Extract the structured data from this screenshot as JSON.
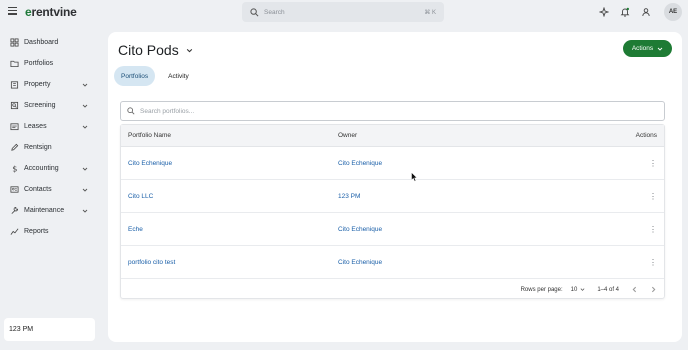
{
  "app": {
    "logo_prefix": "e",
    "logo_rest": "rentvine"
  },
  "topbar": {
    "search_placeholder": "Search",
    "search_shortcut": "⌘ K",
    "icons": [
      "sparkle-icon",
      "bell-icon",
      "user-settings-icon"
    ],
    "avatar_initials": "AE"
  },
  "sidebar": {
    "items": [
      {
        "label": "Dashboard",
        "icon": "dashboard-icon",
        "expandable": false
      },
      {
        "label": "Portfolios",
        "icon": "folder-icon",
        "expandable": false
      },
      {
        "label": "Property",
        "icon": "building-icon",
        "expandable": true
      },
      {
        "label": "Screening",
        "icon": "screening-icon",
        "expandable": true
      },
      {
        "label": "Leases",
        "icon": "lease-icon",
        "expandable": true
      },
      {
        "label": "Rentsign",
        "icon": "pen-icon",
        "expandable": false
      },
      {
        "label": "Accounting",
        "icon": "dollar-icon",
        "expandable": true
      },
      {
        "label": "Contacts",
        "icon": "contacts-icon",
        "expandable": true
      },
      {
        "label": "Maintenance",
        "icon": "wrench-icon",
        "expandable": true
      },
      {
        "label": "Reports",
        "icon": "chart-icon",
        "expandable": false
      }
    ],
    "account_name": "123 PM"
  },
  "main": {
    "title": "Cito Pods",
    "actions_label": "Actions",
    "tabs": [
      {
        "label": "Portfolios",
        "active": true
      },
      {
        "label": "Activity",
        "active": false
      }
    ],
    "search_placeholder": "Search portfolios...",
    "table": {
      "headers": [
        "Portfolio Name",
        "Owner",
        "Actions"
      ],
      "rows": [
        {
          "name": "Cito Echenique",
          "owner": "Cito Echenique"
        },
        {
          "name": "Cito LLC",
          "owner": "123 PM"
        },
        {
          "name": "Eche",
          "owner": "Cito Echenique"
        },
        {
          "name": "portfolio cito test",
          "owner": "Cito Echenique"
        }
      ]
    },
    "pagination": {
      "rows_per_page_label": "Rows per page:",
      "rows_per_page": "10",
      "range": "1–4 of 4"
    }
  },
  "colors": {
    "brand_green": "#1e7b34",
    "link_blue": "#1a5fa8",
    "active_tab_bg": "#d5e6f2"
  }
}
